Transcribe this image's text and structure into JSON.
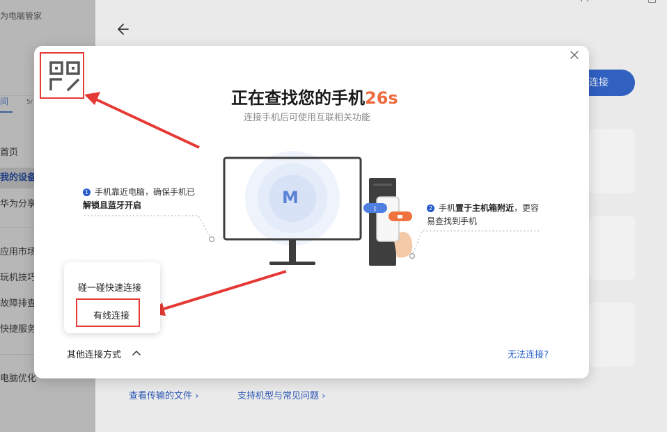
{
  "app": {
    "title": "为电脑管家"
  },
  "sidebar": {
    "tab_active": "间",
    "tab_other": "5/",
    "items": [
      {
        "label": "首页",
        "active": false
      },
      {
        "label": "我的设备",
        "active": true
      },
      {
        "label": "华为分享",
        "active": false
      },
      {
        "label": "应用市场",
        "active": false
      },
      {
        "label": "玩机技巧",
        "active": false
      },
      {
        "label": "故障排查",
        "active": false
      },
      {
        "label": "快捷服务",
        "active": false
      },
      {
        "label": "电脑优化",
        "active": false
      }
    ]
  },
  "main": {
    "connect_label": "连接",
    "links": {
      "files": "查看传输的文件 ›",
      "models": "支持机型与常见问题 ›"
    }
  },
  "dialog": {
    "title": "正在查找您的手机",
    "countdown": "26s",
    "subtitle": "连接手机后可使用互联相关功能",
    "step1": {
      "num": "1",
      "text_a": "手机靠近电脑，确保手机已",
      "text_b": "解锁且蓝牙开启"
    },
    "step2": {
      "num": "2",
      "text_a": "手机",
      "text_bold": "置于主机箱附近",
      "text_c": "，更容",
      "text_d": "易查找到手机"
    },
    "monitor_logo": "M",
    "menu": {
      "item1": "碰一碰快速连接",
      "item2": "有线连接"
    },
    "other_ways": "其他连接方式",
    "cant_connect": "无法连接?"
  },
  "colors": {
    "accent": "#2559c9",
    "countdown": "#ec6a3c",
    "annotation": "#e53935"
  },
  "icons": [
    "qr-code-icon",
    "close-icon",
    "back-arrow-icon",
    "chevron-up-icon",
    "bluetooth-icon",
    "lock-icon"
  ]
}
